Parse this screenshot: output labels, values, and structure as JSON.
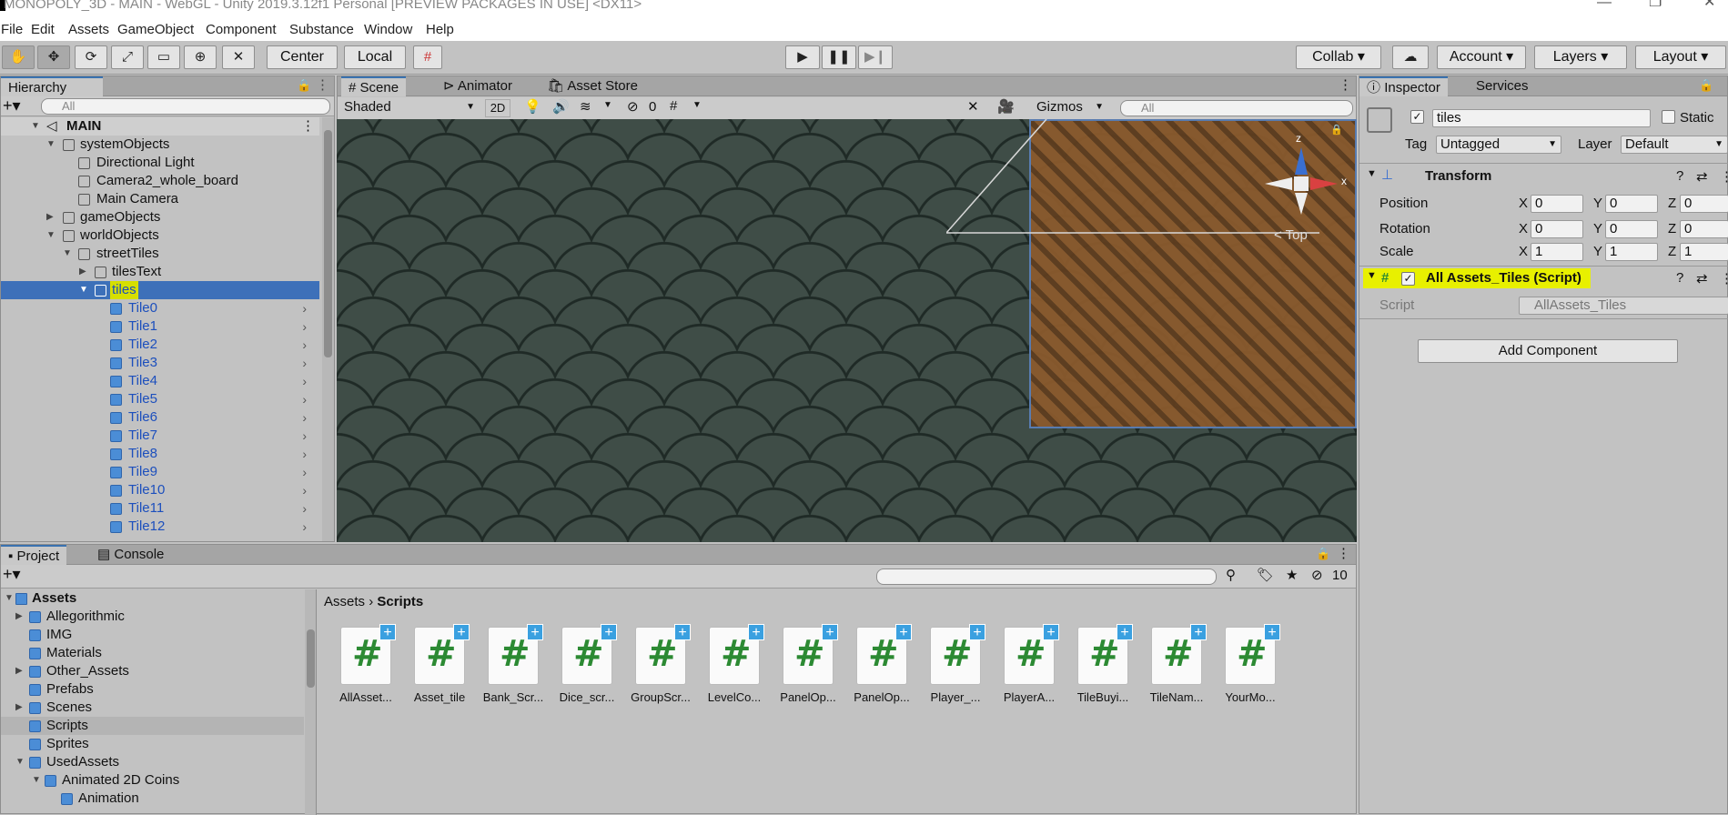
{
  "window": {
    "title": "MONOPOLY_3D - MAIN - WebGL - Unity 2019.3.12f1 Personal [PREVIEW PACKAGES IN USE] <DX11>",
    "minimize": "—",
    "restore": "❐",
    "close": "✕"
  },
  "menu": [
    "File",
    "Edit",
    "Assets",
    "GameObject",
    "Component",
    "Substance",
    "Window",
    "Help"
  ],
  "toolbar": {
    "pivot": "Center",
    "space": "Local",
    "collab": "Collab",
    "account": "Account",
    "layers": "Layers",
    "layout": "Layout"
  },
  "hierarchy": {
    "tab": "Hierarchy",
    "search_placeholder": "All",
    "rows": [
      {
        "label": "MAIN"
      },
      {
        "label": "systemObjects"
      },
      {
        "label": "Directional Light"
      },
      {
        "label": "Camera2_whole_board"
      },
      {
        "label": "Main Camera"
      },
      {
        "label": "gameObjects"
      },
      {
        "label": "worldObjects"
      },
      {
        "label": "streetTiles"
      },
      {
        "label": "tilesText"
      },
      {
        "label": "tiles"
      },
      {
        "label": "Tile0"
      },
      {
        "label": "Tile1"
      },
      {
        "label": "Tile2"
      },
      {
        "label": "Tile3"
      },
      {
        "label": "Tile4"
      },
      {
        "label": "Tile5"
      },
      {
        "label": "Tile6"
      },
      {
        "label": "Tile7"
      },
      {
        "label": "Tile8"
      },
      {
        "label": "Tile9"
      },
      {
        "label": "Tile10"
      },
      {
        "label": "Tile11"
      },
      {
        "label": "Tile12"
      }
    ]
  },
  "scene_tabs": {
    "scene": "Scene",
    "animator": "Animator",
    "asset_store": "Asset Store"
  },
  "scene_toolbar": {
    "shading": "Shaded",
    "mode_2d": "2D",
    "hidden_count": "0",
    "gizmos": "Gizmos",
    "search_placeholder": "All",
    "view_label": "< Top",
    "axis_x": "x",
    "axis_z": "z"
  },
  "inspector": {
    "tab": "Inspector",
    "services_tab": "Services",
    "object_name": "tiles",
    "static_label": "Static",
    "tag_label": "Tag",
    "tag_value": "Untagged",
    "layer_label": "Layer",
    "layer_value": "Default",
    "transform": {
      "title": "Transform",
      "position_label": "Position",
      "rotation_label": "Rotation",
      "scale_label": "Scale",
      "position": {
        "x": "0",
        "y": "0",
        "z": "0"
      },
      "rotation": {
        "x": "0",
        "y": "0",
        "z": "0"
      },
      "scale": {
        "x": "1",
        "y": "1",
        "z": "1"
      }
    },
    "script_component": {
      "title": "All Assets_Tiles (Script)",
      "script_label": "Script",
      "script_value": "AllAssets_Tiles"
    },
    "add_component": "Add Component"
  },
  "project": {
    "tab": "Project",
    "console_tab": "Console",
    "hidden_count": "10",
    "breadcrumb": [
      "Assets",
      "Scripts"
    ],
    "tree": [
      {
        "label": "Assets"
      },
      {
        "label": "Allegorithmic"
      },
      {
        "label": "IMG"
      },
      {
        "label": "Materials"
      },
      {
        "label": "Other_Assets"
      },
      {
        "label": "Prefabs"
      },
      {
        "label": "Scenes"
      },
      {
        "label": "Scripts"
      },
      {
        "label": "Sprites"
      },
      {
        "label": "UsedAssets"
      },
      {
        "label": "Animated 2D Coins"
      },
      {
        "label": "Animation"
      }
    ],
    "assets": [
      "AllAsset...",
      "Asset_tile",
      "Bank_Scr...",
      "Dice_scr...",
      "GroupScr...",
      "LevelCo...",
      "PanelOp...",
      "PanelOp...",
      "Player_...",
      "PlayerA...",
      "TileBuyi...",
      "TileNam...",
      "YourMo..."
    ]
  },
  "colors": {
    "selection": "#3d70b9",
    "highlight": "#d6df00",
    "script_green": "#2c8a33"
  }
}
